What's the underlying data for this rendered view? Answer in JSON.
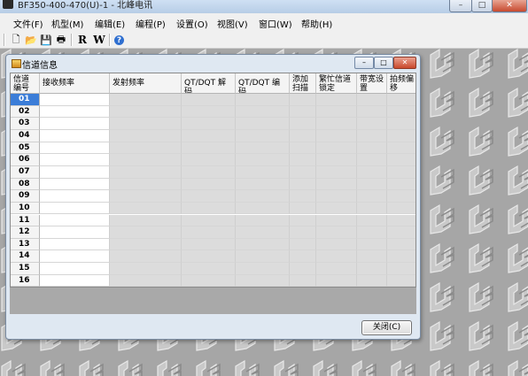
{
  "window": {
    "title": "BF350-400-470(U)-1 - 北峰电讯",
    "controls": {
      "minimize": "–",
      "maximize": "□",
      "close": "✕"
    }
  },
  "menu": [
    {
      "label": "文件(F)"
    },
    {
      "label": "机型(M)"
    },
    {
      "label": "编辑(E)"
    },
    {
      "label": "编程(P)"
    },
    {
      "label": "设置(O)"
    },
    {
      "label": "视图(V)"
    },
    {
      "label": "窗口(W)"
    },
    {
      "label": "帮助(H)"
    }
  ],
  "toolbar": [
    {
      "name": "new-icon",
      "glyph": "🗋"
    },
    {
      "name": "open-icon",
      "glyph": "📂"
    },
    {
      "name": "save-icon",
      "glyph": "💾"
    },
    {
      "name": "print-icon",
      "glyph": "🖶"
    },
    {
      "name": "read-button",
      "glyph": "R"
    },
    {
      "name": "write-button",
      "glyph": "W"
    },
    {
      "name": "help-icon",
      "glyph": "?"
    }
  ],
  "child_window": {
    "title": "信道信息",
    "controls": {
      "minimize": "–",
      "maximize": "□",
      "close": "✕"
    },
    "close_label": "关闭(C)"
  },
  "table": {
    "columns": [
      {
        "label": "信道编号"
      },
      {
        "label": "接收频率"
      },
      {
        "label": "发射频率"
      },
      {
        "label": "QT/DQT 解码"
      },
      {
        "label": "QT/DQT 编码"
      },
      {
        "label": "添加扫描"
      },
      {
        "label": "繁忙信道锁定"
      },
      {
        "label": "带宽设置"
      },
      {
        "label": "拍频偏移"
      }
    ],
    "rows": [
      "01",
      "02",
      "03",
      "04",
      "05",
      "06",
      "07",
      "08",
      "09",
      "10",
      "11",
      "12",
      "13",
      "14",
      "15",
      "16"
    ],
    "selected_row": "01"
  },
  "colors": {
    "selected_row": "#3b7dd8",
    "workspace": "#a6a6a6",
    "child_frame": "#dfe8f2"
  }
}
